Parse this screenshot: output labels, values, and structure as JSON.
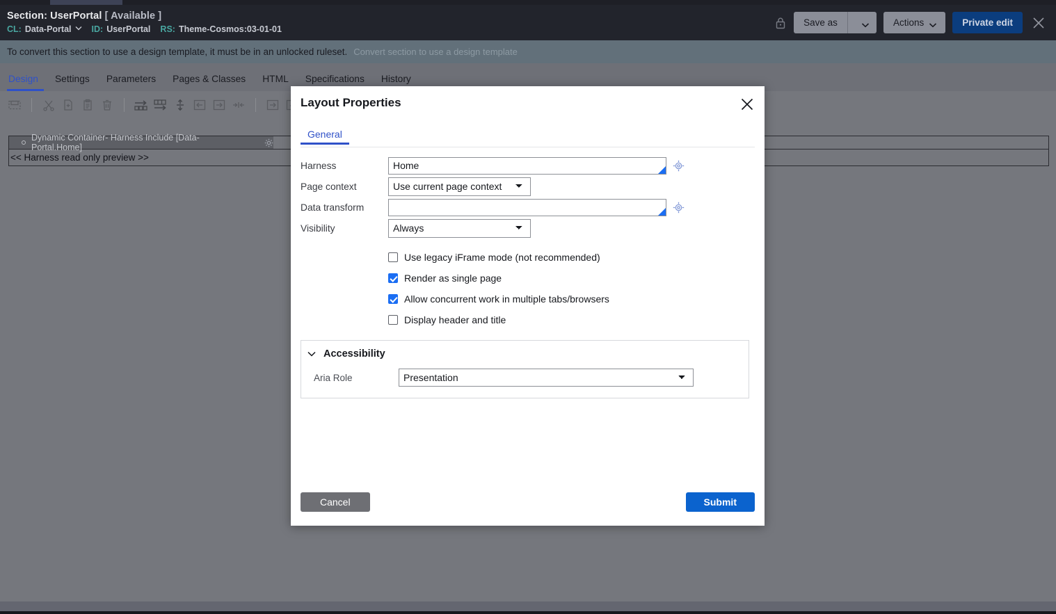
{
  "header": {
    "title_prefix": "Section: UserPortal",
    "title_status": "[ Available ]",
    "meta": {
      "cl_label": "CL:",
      "cl_value": "Data-Portal",
      "id_label": "ID:",
      "id_value": "UserPortal",
      "rs_label": "RS:",
      "rs_value": "Theme-Cosmos:03-01-01"
    },
    "actions": {
      "save_as": "Save as",
      "actions": "Actions",
      "private_edit": "Private edit"
    }
  },
  "notice": {
    "message": "To convert this section to use a design template, it must be in an unlocked ruleset.",
    "link": "Convert section to use a design template"
  },
  "tabs": [
    {
      "label": "Design",
      "active": true
    },
    {
      "label": "Settings",
      "active": false
    },
    {
      "label": "Parameters",
      "active": false
    },
    {
      "label": "Pages & Classes",
      "active": false
    },
    {
      "label": "HTML",
      "active": false
    },
    {
      "label": "Specifications",
      "active": false
    },
    {
      "label": "History",
      "active": false
    }
  ],
  "toolbar": {
    "icons": [
      "select-region-icon",
      "cut-icon",
      "copy-icon",
      "paste-icon",
      "delete-icon",
      "insert-row-icon",
      "insert-column-icon",
      "distribute-vertical-icon",
      "insert-left-icon",
      "insert-right-icon",
      "merge-cells-icon",
      "move-right-icon",
      "move-down-icon",
      "columns-icon"
    ]
  },
  "canvas": {
    "container_label": "Dynamic Container- Harness Include [Data-Portal.Home]",
    "preview_text": "<< Harness read only preview >>"
  },
  "dialog": {
    "title": "Layout Properties",
    "tabs": [
      {
        "label": "General",
        "active": true
      }
    ],
    "fields": {
      "harness_label": "Harness",
      "harness_value": "Home",
      "page_context_label": "Page context",
      "page_context_value": "Use current page context",
      "page_context_options": [
        "Use current page context"
      ],
      "data_transform_label": "Data transform",
      "data_transform_value": "",
      "visibility_label": "Visibility",
      "visibility_value": "Always",
      "visibility_options": [
        "Always"
      ]
    },
    "checkboxes": [
      {
        "label": "Use legacy iFrame mode (not recommended)",
        "checked": false
      },
      {
        "label": "Render as single page",
        "checked": true
      },
      {
        "label": "Allow concurrent work in multiple tabs/browsers",
        "checked": true
      },
      {
        "label": "Display header and title",
        "checked": false
      }
    ],
    "accessibility": {
      "section_title": "Accessibility",
      "aria_role_label": "Aria Role",
      "aria_role_value": "Presentation",
      "aria_role_options": [
        "Presentation"
      ]
    },
    "footer": {
      "cancel": "Cancel",
      "submit": "Submit"
    }
  },
  "colors": {
    "accent_blue": "#2f51c8",
    "primary_blue": "#0b63ce",
    "header_dark": "#22242c",
    "notice_bg": "#62707a",
    "canvas_gray": "#75777d",
    "teal_label": "#49a6a0"
  }
}
